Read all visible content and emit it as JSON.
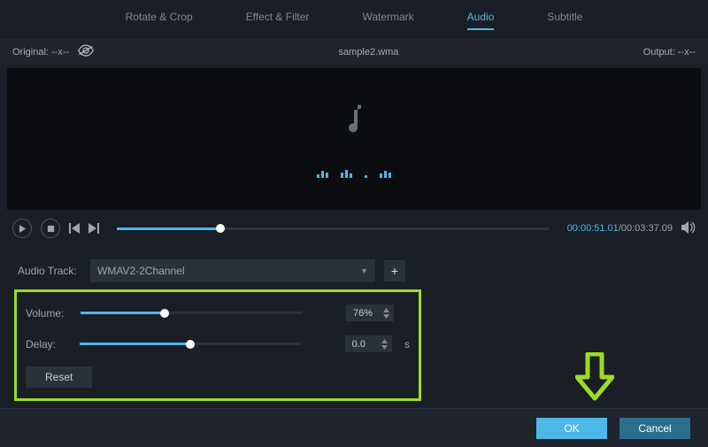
{
  "tabs": [
    {
      "label": "Rotate & Crop",
      "active": false
    },
    {
      "label": "Effect & Filter",
      "active": false
    },
    {
      "label": "Watermark",
      "active": false
    },
    {
      "label": "Audio",
      "active": true
    },
    {
      "label": "Subtitle",
      "active": false
    }
  ],
  "subheader": {
    "original": "Original:  --x--",
    "filename": "sample2.wma",
    "output": "Output:  --x--"
  },
  "playback": {
    "current": "00:00:51.01",
    "total": "00:03:37.09",
    "progress_pct": 24
  },
  "track": {
    "label": "Audio Track:",
    "value": "WMAV2-2Channel"
  },
  "settings": {
    "volume": {
      "label": "Volume:",
      "value": "76%",
      "pct": 38
    },
    "delay": {
      "label": "Delay:",
      "value": "0.0",
      "unit": "s",
      "pct": 50
    },
    "reset": "Reset"
  },
  "footer": {
    "ok": "OK",
    "cancel": "Cancel"
  }
}
